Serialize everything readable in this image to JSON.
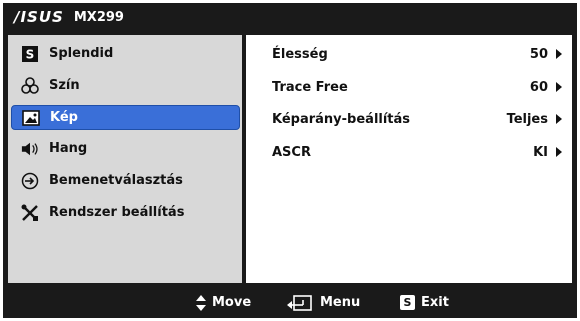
{
  "title": {
    "brand": "/ISUS",
    "model": "MX299"
  },
  "sidebar": {
    "items": [
      {
        "label": "Splendid",
        "icon": "splendid-icon"
      },
      {
        "label": "Szín",
        "icon": "color-icon"
      },
      {
        "label": "Kép",
        "icon": "image-icon",
        "selected": true
      },
      {
        "label": "Hang",
        "icon": "speaker-icon"
      },
      {
        "label": "Bemenetválasztás",
        "icon": "input-icon"
      },
      {
        "label": "Rendszer beállítás",
        "icon": "tools-icon"
      }
    ]
  },
  "main": {
    "rows": [
      {
        "label": "Élesség",
        "value": "50"
      },
      {
        "label": "Trace Free",
        "value": "60"
      },
      {
        "label": "Képarány-beállítás",
        "value": "Teljes"
      },
      {
        "label": "ASCR",
        "value": "KI"
      }
    ]
  },
  "footer": {
    "move_label": "Move",
    "menu_label": "Menu",
    "exit_label": "Exit",
    "exit_key": "S"
  },
  "colors": {
    "frame": "#1a1a1a",
    "sidebar": "#d8d8d8",
    "selected": "#3a6fd8",
    "panel": "#ffffff"
  }
}
